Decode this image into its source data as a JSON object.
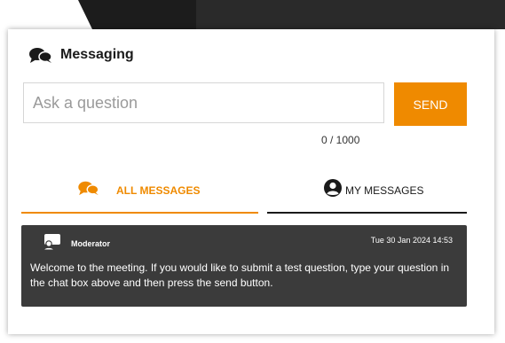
{
  "colors": {
    "accent": "#ef8a00",
    "dark": "#222222",
    "card": "#3b3b3b"
  },
  "header": {
    "title": "Messaging",
    "icon": "chat-bubbles-icon"
  },
  "composer": {
    "placeholder": "Ask a question",
    "value": "",
    "send_label": "SEND",
    "char_count": "0 / 1000"
  },
  "tabs": [
    {
      "label": "ALL MESSAGES",
      "icon": "chat-bubbles-icon",
      "active": true
    },
    {
      "label": "MY MESSAGES",
      "icon": "user-circle-icon",
      "active": false
    }
  ],
  "messages": [
    {
      "author": "Moderator",
      "timestamp": "Tue 30 Jan 2024 14:53",
      "icon": "moderator-icon",
      "text": "Welcome to the meeting. If you would like to submit a test question, type your question in the chat box above and then press the send button."
    }
  ]
}
